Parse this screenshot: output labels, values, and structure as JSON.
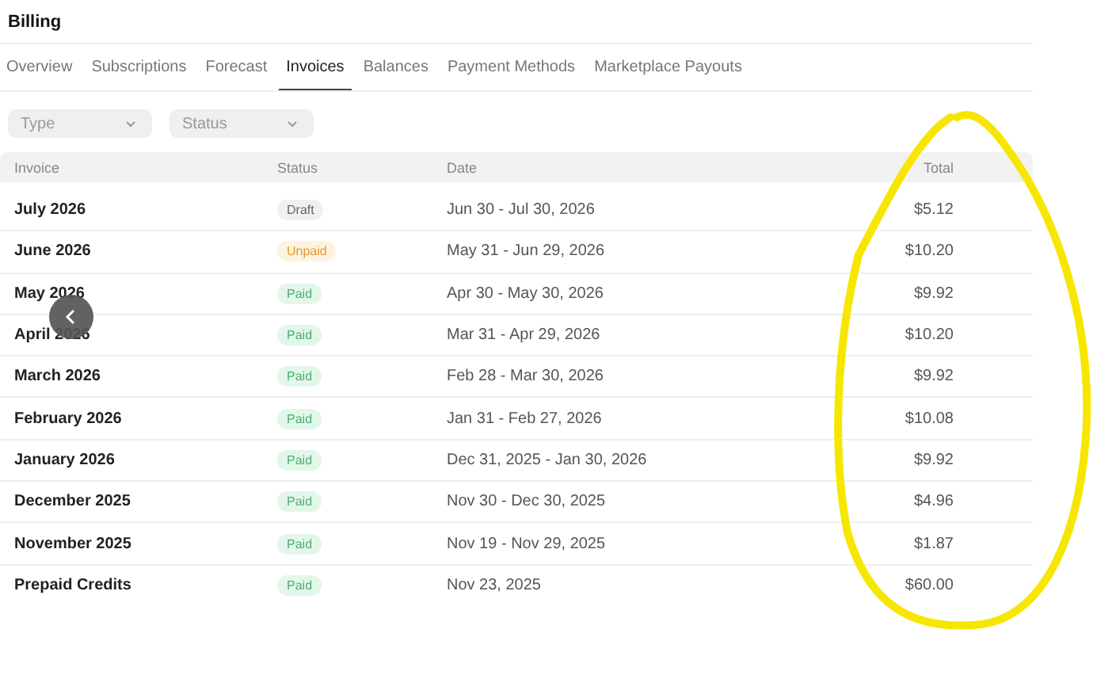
{
  "page": {
    "title": "Billing"
  },
  "tabs": [
    {
      "label": "Overview",
      "selected": false
    },
    {
      "label": "Subscriptions",
      "selected": false
    },
    {
      "label": "Forecast",
      "selected": false
    },
    {
      "label": "Invoices",
      "selected": true
    },
    {
      "label": "Balances",
      "selected": false
    },
    {
      "label": "Payment Methods",
      "selected": false
    },
    {
      "label": "Marketplace Payouts",
      "selected": false
    }
  ],
  "filters": [
    {
      "placeholder": "Type"
    },
    {
      "placeholder": "Status"
    }
  ],
  "table": {
    "columns": [
      "Invoice",
      "Status",
      "Date",
      "Total"
    ],
    "rows": [
      {
        "invoice": "July 2026",
        "status": "Draft",
        "kind": "draft",
        "date": "Jun 30 - Jul 30, 2026",
        "total": "$5.12"
      },
      {
        "invoice": "June 2026",
        "status": "Unpaid",
        "kind": "unpaid",
        "date": "May 31 - Jun 29, 2026",
        "total": "$10.20"
      },
      {
        "invoice": "May 2026",
        "status": "Paid",
        "kind": "paid",
        "date": "Apr 30 - May 30, 2026",
        "total": "$9.92"
      },
      {
        "invoice": "April 2026",
        "status": "Paid",
        "kind": "paid",
        "date": "Mar 31 - Apr 29, 2026",
        "total": "$10.20"
      },
      {
        "invoice": "March 2026",
        "status": "Paid",
        "kind": "paid",
        "date": "Feb 28 - Mar 30, 2026",
        "total": "$9.92"
      },
      {
        "invoice": "February 2026",
        "status": "Paid",
        "kind": "paid",
        "date": "Jan 31 - Feb 27, 2026",
        "total": "$10.08"
      },
      {
        "invoice": "January 2026",
        "status": "Paid",
        "kind": "paid",
        "date": "Dec 31, 2025 - Jan 30, 2026",
        "total": "$9.92"
      },
      {
        "invoice": "December 2025",
        "status": "Paid",
        "kind": "paid",
        "date": "Nov 30 - Dec 30, 2025",
        "total": "$4.96"
      },
      {
        "invoice": "November 2025",
        "status": "Paid",
        "kind": "paid",
        "date": "Nov 19 - Nov 29, 2025",
        "total": "$1.87"
      },
      {
        "invoice": "Prepaid Credits",
        "status": "Paid",
        "kind": "paid",
        "date": "Nov 23, 2025",
        "total": "$60.00"
      }
    ]
  }
}
